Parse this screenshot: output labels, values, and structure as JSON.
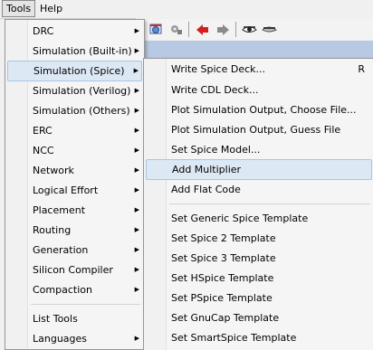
{
  "menubar": {
    "tools": "Tools",
    "help": "Help"
  },
  "toolbar": {
    "icons": [
      "window-globe-icon",
      "gear-icon",
      "back-arrow-icon",
      "forward-arrow-icon",
      "eye-open-icon",
      "eye-closed-icon"
    ]
  },
  "tools_menu": {
    "items": [
      {
        "label": "DRC"
      },
      {
        "label": "Simulation (Built-in)"
      },
      {
        "label": "Simulation (Spice)"
      },
      {
        "label": "Simulation (Verilog)"
      },
      {
        "label": "Simulation (Others)"
      },
      {
        "label": "ERC"
      },
      {
        "label": "NCC"
      },
      {
        "label": "Network"
      },
      {
        "label": "Logical Effort"
      },
      {
        "label": "Placement"
      },
      {
        "label": "Routing"
      },
      {
        "label": "Generation"
      },
      {
        "label": "Silicon Compiler"
      },
      {
        "label": "Compaction"
      },
      {
        "label": "List Tools"
      },
      {
        "label": "Languages"
      }
    ]
  },
  "spice_menu": {
    "items": [
      {
        "label": "Write Spice Deck...",
        "shortcut": "R"
      },
      {
        "label": "Write CDL Deck..."
      },
      {
        "label": "Plot Simulation Output, Choose File..."
      },
      {
        "label": "Plot Simulation Output, Guess File"
      },
      {
        "label": "Set Spice Model..."
      },
      {
        "label": "Add Multiplier"
      },
      {
        "label": "Add Flat Code"
      },
      {
        "label": "Set Generic Spice Template"
      },
      {
        "label": "Set Spice 2 Template"
      },
      {
        "label": "Set Spice 3 Template"
      },
      {
        "label": "Set HSpice Template"
      },
      {
        "label": "Set PSpice Template"
      },
      {
        "label": "Set GnuCap Template"
      },
      {
        "label": "Set SmartSpice Template"
      }
    ]
  }
}
